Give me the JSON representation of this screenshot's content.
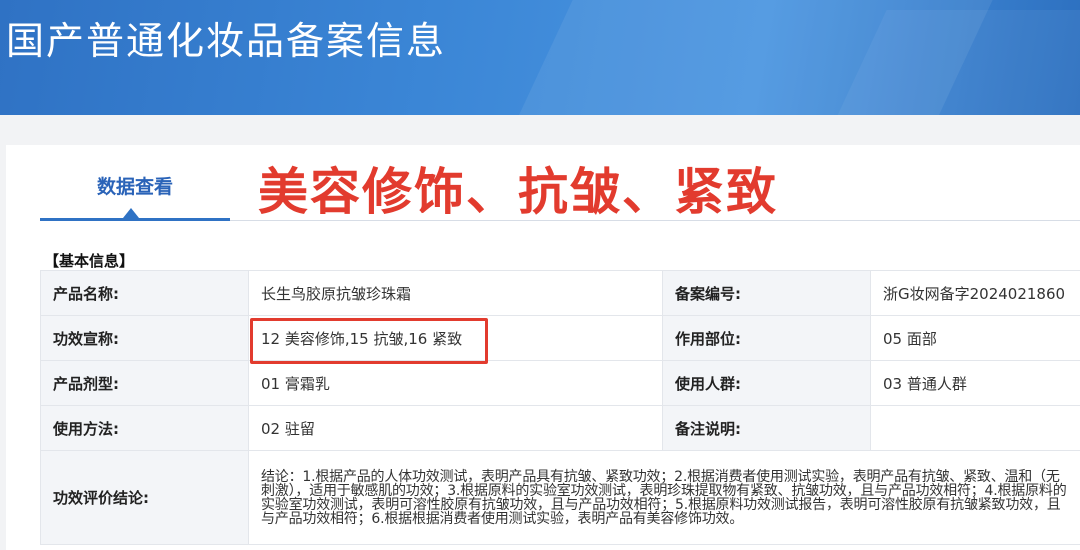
{
  "header": {
    "title": "国产普通化妆品备案信息"
  },
  "tab": {
    "label": "数据查看"
  },
  "annotation": {
    "text": "美容修饰、抗皱、紧致",
    "color": "#e23b2e"
  },
  "section": {
    "title": "【基本信息】"
  },
  "rows": [
    {
      "label1": "产品名称:",
      "value1": "长生鸟胶原抗皱珍珠霜",
      "label2": "备案编号:",
      "value2": "浙G妆网备字2024021860"
    },
    {
      "label1": "功效宣称:",
      "value1": "12 美容修饰,15 抗皱,16 紧致",
      "label2": "作用部位:",
      "value2": "05 面部"
    },
    {
      "label1": "产品剂型:",
      "value1": "01 膏霜乳",
      "label2": "使用人群:",
      "value2": "03 普通人群"
    },
    {
      "label1": "使用方法:",
      "value1": "02 驻留",
      "label2": "备注说明:",
      "value2": ""
    }
  ],
  "conclusion": {
    "label": "功效评价结论:",
    "text": "结论：1.根据产品的人体功效测试，表明产品具有抗皱、紧致功效；2.根据消费者使用测试实验，表明产品有抗皱、紧致、温和（无刺激），适用于敏感肌的功效；3.根据原料的实验室功效测试，表明珍珠提取物有紧致、抗皱功效，且与产品功效相符；4.根据原料的实验室功效测试，表明可溶性胶原有抗皱功效，且与产品功效相符；5.根据原料功效测试报告，表明可溶性胶原有抗皱紧致功效，且与产品功效相符；6.根据根据消费者使用测试实验，表明产品有美容修饰功效。"
  },
  "colors": {
    "banner": "#3b86d6",
    "accent": "#2f72c4",
    "label_bg": "#f3f5f8"
  }
}
